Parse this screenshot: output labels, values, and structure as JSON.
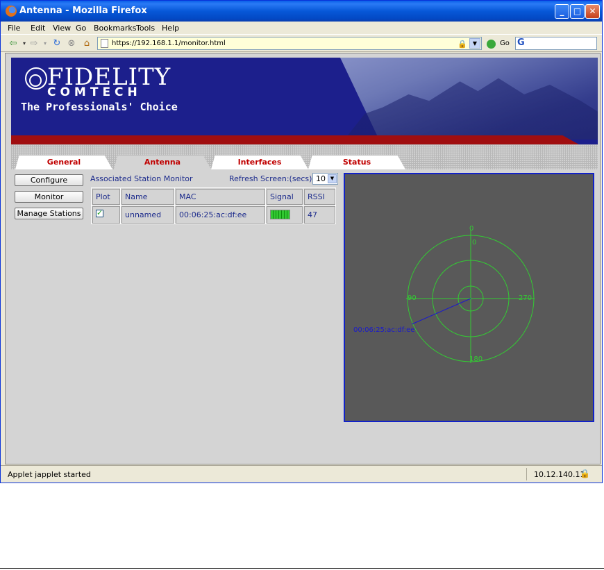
{
  "window": {
    "title": "Antenna - Mozilla Firefox",
    "buttons": [
      "minimize",
      "maximize",
      "close"
    ]
  },
  "menu": [
    "File",
    "Edit",
    "View",
    "Go",
    "Bookmarks",
    "Tools",
    "Help"
  ],
  "navbar": {
    "url": "https://192.168.1.1/monitor.html",
    "go_label": "Go",
    "search_engine_glyph": "G"
  },
  "banner": {
    "brand_top": "FIDELITY",
    "brand_bottom": "COMTECH",
    "tagline": "The Professionals' Choice"
  },
  "tabs": [
    {
      "label": "General",
      "active": false
    },
    {
      "label": "Antenna",
      "active": true
    },
    {
      "label": "Interfaces",
      "active": false
    },
    {
      "label": "Status",
      "active": false
    }
  ],
  "side_buttons": [
    "Configure",
    "Monitor",
    "Manage Stations"
  ],
  "monitor": {
    "title": "Associated Station Monitor",
    "refresh_label": "Refresh Screen:(secs)",
    "refresh_value": "10",
    "columns": [
      "Plot",
      "Name",
      "MAC",
      "Signal",
      "RSSI"
    ],
    "rows": [
      {
        "plot": true,
        "name": "unnamed",
        "mac": "00:06:25:ac:df:ee",
        "signal_level": 1.0,
        "rssi": "47"
      }
    ]
  },
  "radar": {
    "labels": {
      "north": "0",
      "west": "90",
      "east": "270",
      "south": "180"
    },
    "north_marker": "0",
    "station_label": "00:06:25:ac:df:ee",
    "ring_color": "#33cc33",
    "vector_color": "#1a1acc",
    "station_bearing_deg": 110,
    "station_range": 1.0
  },
  "status": {
    "text": "Applet japplet started",
    "ip": "10.12.140.11"
  },
  "colors": {
    "titlebar": "#0758d8",
    "banner": "#1c1f8c",
    "tab_text": "#c00000",
    "table_text": "#1c2b8c",
    "radar_bg": "#595959",
    "radar_border": "#1222c8"
  }
}
